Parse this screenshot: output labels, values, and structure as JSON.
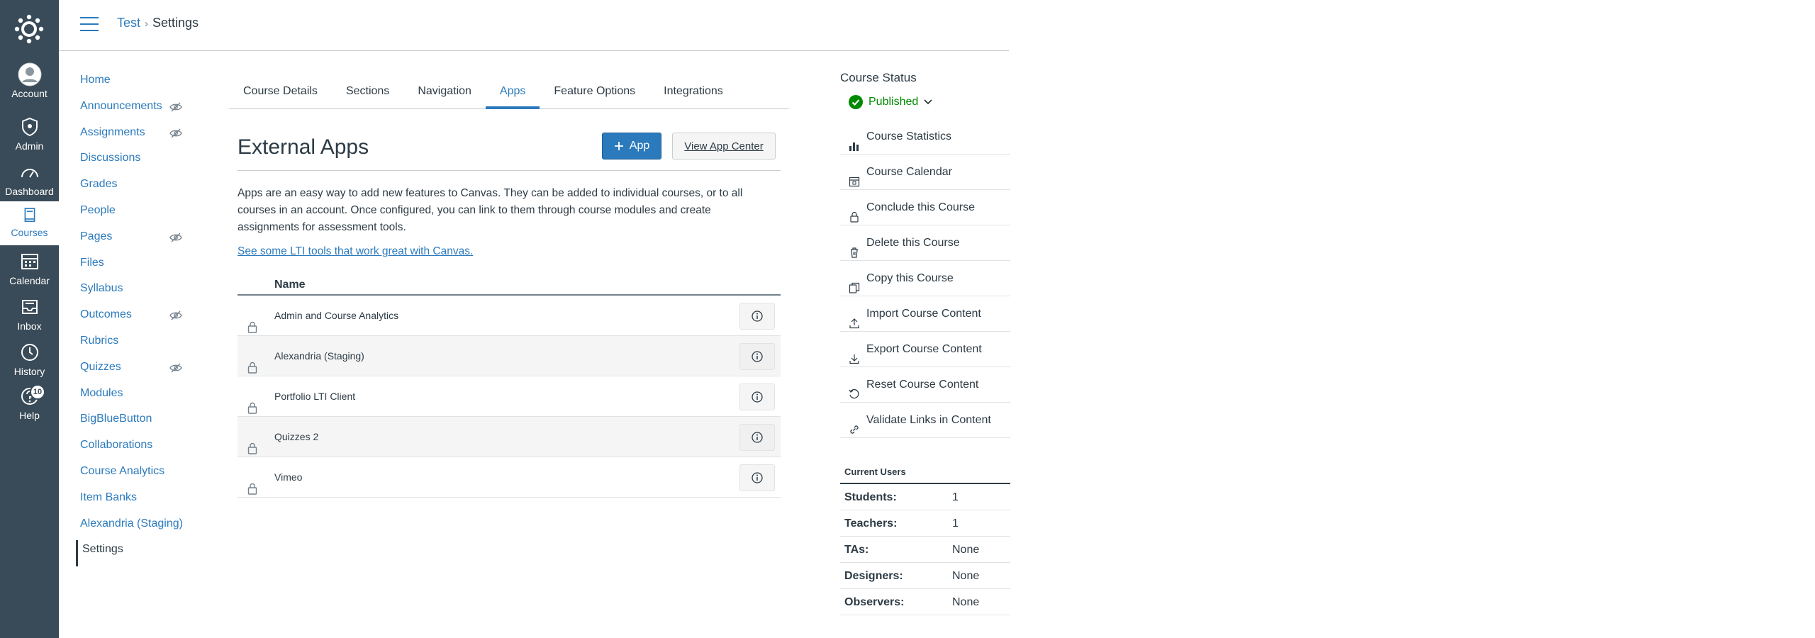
{
  "global_nav": {
    "items": [
      {
        "label": "Account",
        "icon": "account-avatar-icon"
      },
      {
        "label": "Admin",
        "icon": "admin-shield-icon"
      },
      {
        "label": "Dashboard",
        "icon": "dashboard-icon"
      },
      {
        "label": "Courses",
        "icon": "courses-book-icon"
      },
      {
        "label": "Calendar",
        "icon": "calendar-icon"
      },
      {
        "label": "Inbox",
        "icon": "inbox-icon"
      },
      {
        "label": "History",
        "icon": "history-clock-icon"
      },
      {
        "label": "Help",
        "icon": "help-icon"
      }
    ],
    "help_badge": "10",
    "active": "Courses"
  },
  "header": {
    "breadcrumb": {
      "course": "Test",
      "separator": "›",
      "current": "Settings"
    }
  },
  "course_nav": {
    "items": [
      {
        "label": "Home",
        "hidden": false
      },
      {
        "label": "Announcements",
        "hidden": true
      },
      {
        "label": "Assignments",
        "hidden": true
      },
      {
        "label": "Discussions",
        "hidden": false
      },
      {
        "label": "Grades",
        "hidden": false
      },
      {
        "label": "People",
        "hidden": false
      },
      {
        "label": "Pages",
        "hidden": true
      },
      {
        "label": "Files",
        "hidden": false
      },
      {
        "label": "Syllabus",
        "hidden": false
      },
      {
        "label": "Outcomes",
        "hidden": true
      },
      {
        "label": "Rubrics",
        "hidden": false
      },
      {
        "label": "Quizzes",
        "hidden": true
      },
      {
        "label": "Modules",
        "hidden": false
      },
      {
        "label": "BigBlueButton",
        "hidden": false
      },
      {
        "label": "Collaborations",
        "hidden": false
      },
      {
        "label": "Course Analytics",
        "hidden": false
      },
      {
        "label": "Item Banks",
        "hidden": false
      },
      {
        "label": "Alexandria (Staging)",
        "hidden": false
      },
      {
        "label": "Settings",
        "hidden": false
      }
    ],
    "active": "Settings"
  },
  "tabs": {
    "items": [
      "Course Details",
      "Sections",
      "Navigation",
      "Apps",
      "Feature Options",
      "Integrations"
    ],
    "active": "Apps"
  },
  "main": {
    "title": "External Apps",
    "add_app_label": "App",
    "view_center_label": "View App Center",
    "description": "Apps are an easy way to add new features to Canvas. They can be added to individual courses, or to all courses in an account. Once configured, you can link to them through course modules and create assignments for assessment tools.",
    "lti_link": "See some LTI tools that work great with Canvas.",
    "table_header": "Name",
    "apps": [
      "Admin and Course Analytics",
      "Alexandria (Staging)",
      "Portfolio LTI Client",
      "Quizzes 2",
      "Vimeo"
    ]
  },
  "sidebar": {
    "course_status_title": "Course Status",
    "status": "Published",
    "actions": [
      {
        "label": "Course Statistics",
        "icon": "bar-chart-icon"
      },
      {
        "label": "Course Calendar",
        "icon": "calendar-icon"
      },
      {
        "label": "Conclude this Course",
        "icon": "lock-icon"
      },
      {
        "label": "Delete this Course",
        "icon": "trash-icon"
      },
      {
        "label": "Copy this Course",
        "icon": "copy-icon"
      },
      {
        "label": "Import Course Content",
        "icon": "upload-icon"
      },
      {
        "label": "Export Course Content",
        "icon": "download-icon"
      },
      {
        "label": "Reset Course Content",
        "icon": "reset-icon"
      },
      {
        "label": "Validate Links in Content",
        "icon": "link-icon"
      }
    ],
    "current_users_title": "Current Users",
    "users": [
      {
        "label": "Students:",
        "value": "1"
      },
      {
        "label": "Teachers:",
        "value": "1"
      },
      {
        "label": "TAs:",
        "value": "None"
      },
      {
        "label": "Designers:",
        "value": "None"
      },
      {
        "label": "Observers:",
        "value": "None"
      }
    ]
  },
  "colors": {
    "nav_bg": "#394b58",
    "link": "#2b7abc",
    "published": "#008a00",
    "text": "#2d3b45"
  }
}
